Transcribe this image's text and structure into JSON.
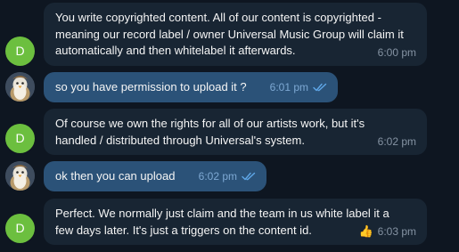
{
  "colors": {
    "background": "#0e1621",
    "incoming_bubble": "#182533",
    "outgoing_bubble": "#2b5278",
    "avatar_letter_bg": "#6cbf3f",
    "read_ticks": "#5fa7e8"
  },
  "messages": [
    {
      "sender": "contact",
      "avatar_letter": "D",
      "text": "You write copyrighted content. All of our content is copyrighted - \nmeaning our record label / owner Universal Music Group will claim it \nautomatically and then whitelabel it afterwards.",
      "time": "6:00 pm"
    },
    {
      "sender": "self",
      "avatar": "penguin-avatar",
      "text": "so you have permission to upload it ?",
      "time": "6:01 pm",
      "status_icon": "double-check-icon"
    },
    {
      "sender": "contact",
      "avatar_letter": "D",
      "text": "Of course we own the rights for all of our artists work, but it's \nhandled / distributed through Universal's system.",
      "time": "6:02 pm"
    },
    {
      "sender": "self",
      "avatar": "penguin-avatar",
      "text": "ok then you can upload",
      "time": "6:02 pm",
      "status_icon": "double-check-icon"
    },
    {
      "sender": "contact",
      "avatar_letter": "D",
      "text": "Perfect. We normally just claim and the team in us white label it a \nfew days later. It's just a triggers on the content id.",
      "time": "6:03 pm",
      "reaction_icon": "thumbs-up-icon"
    }
  ]
}
